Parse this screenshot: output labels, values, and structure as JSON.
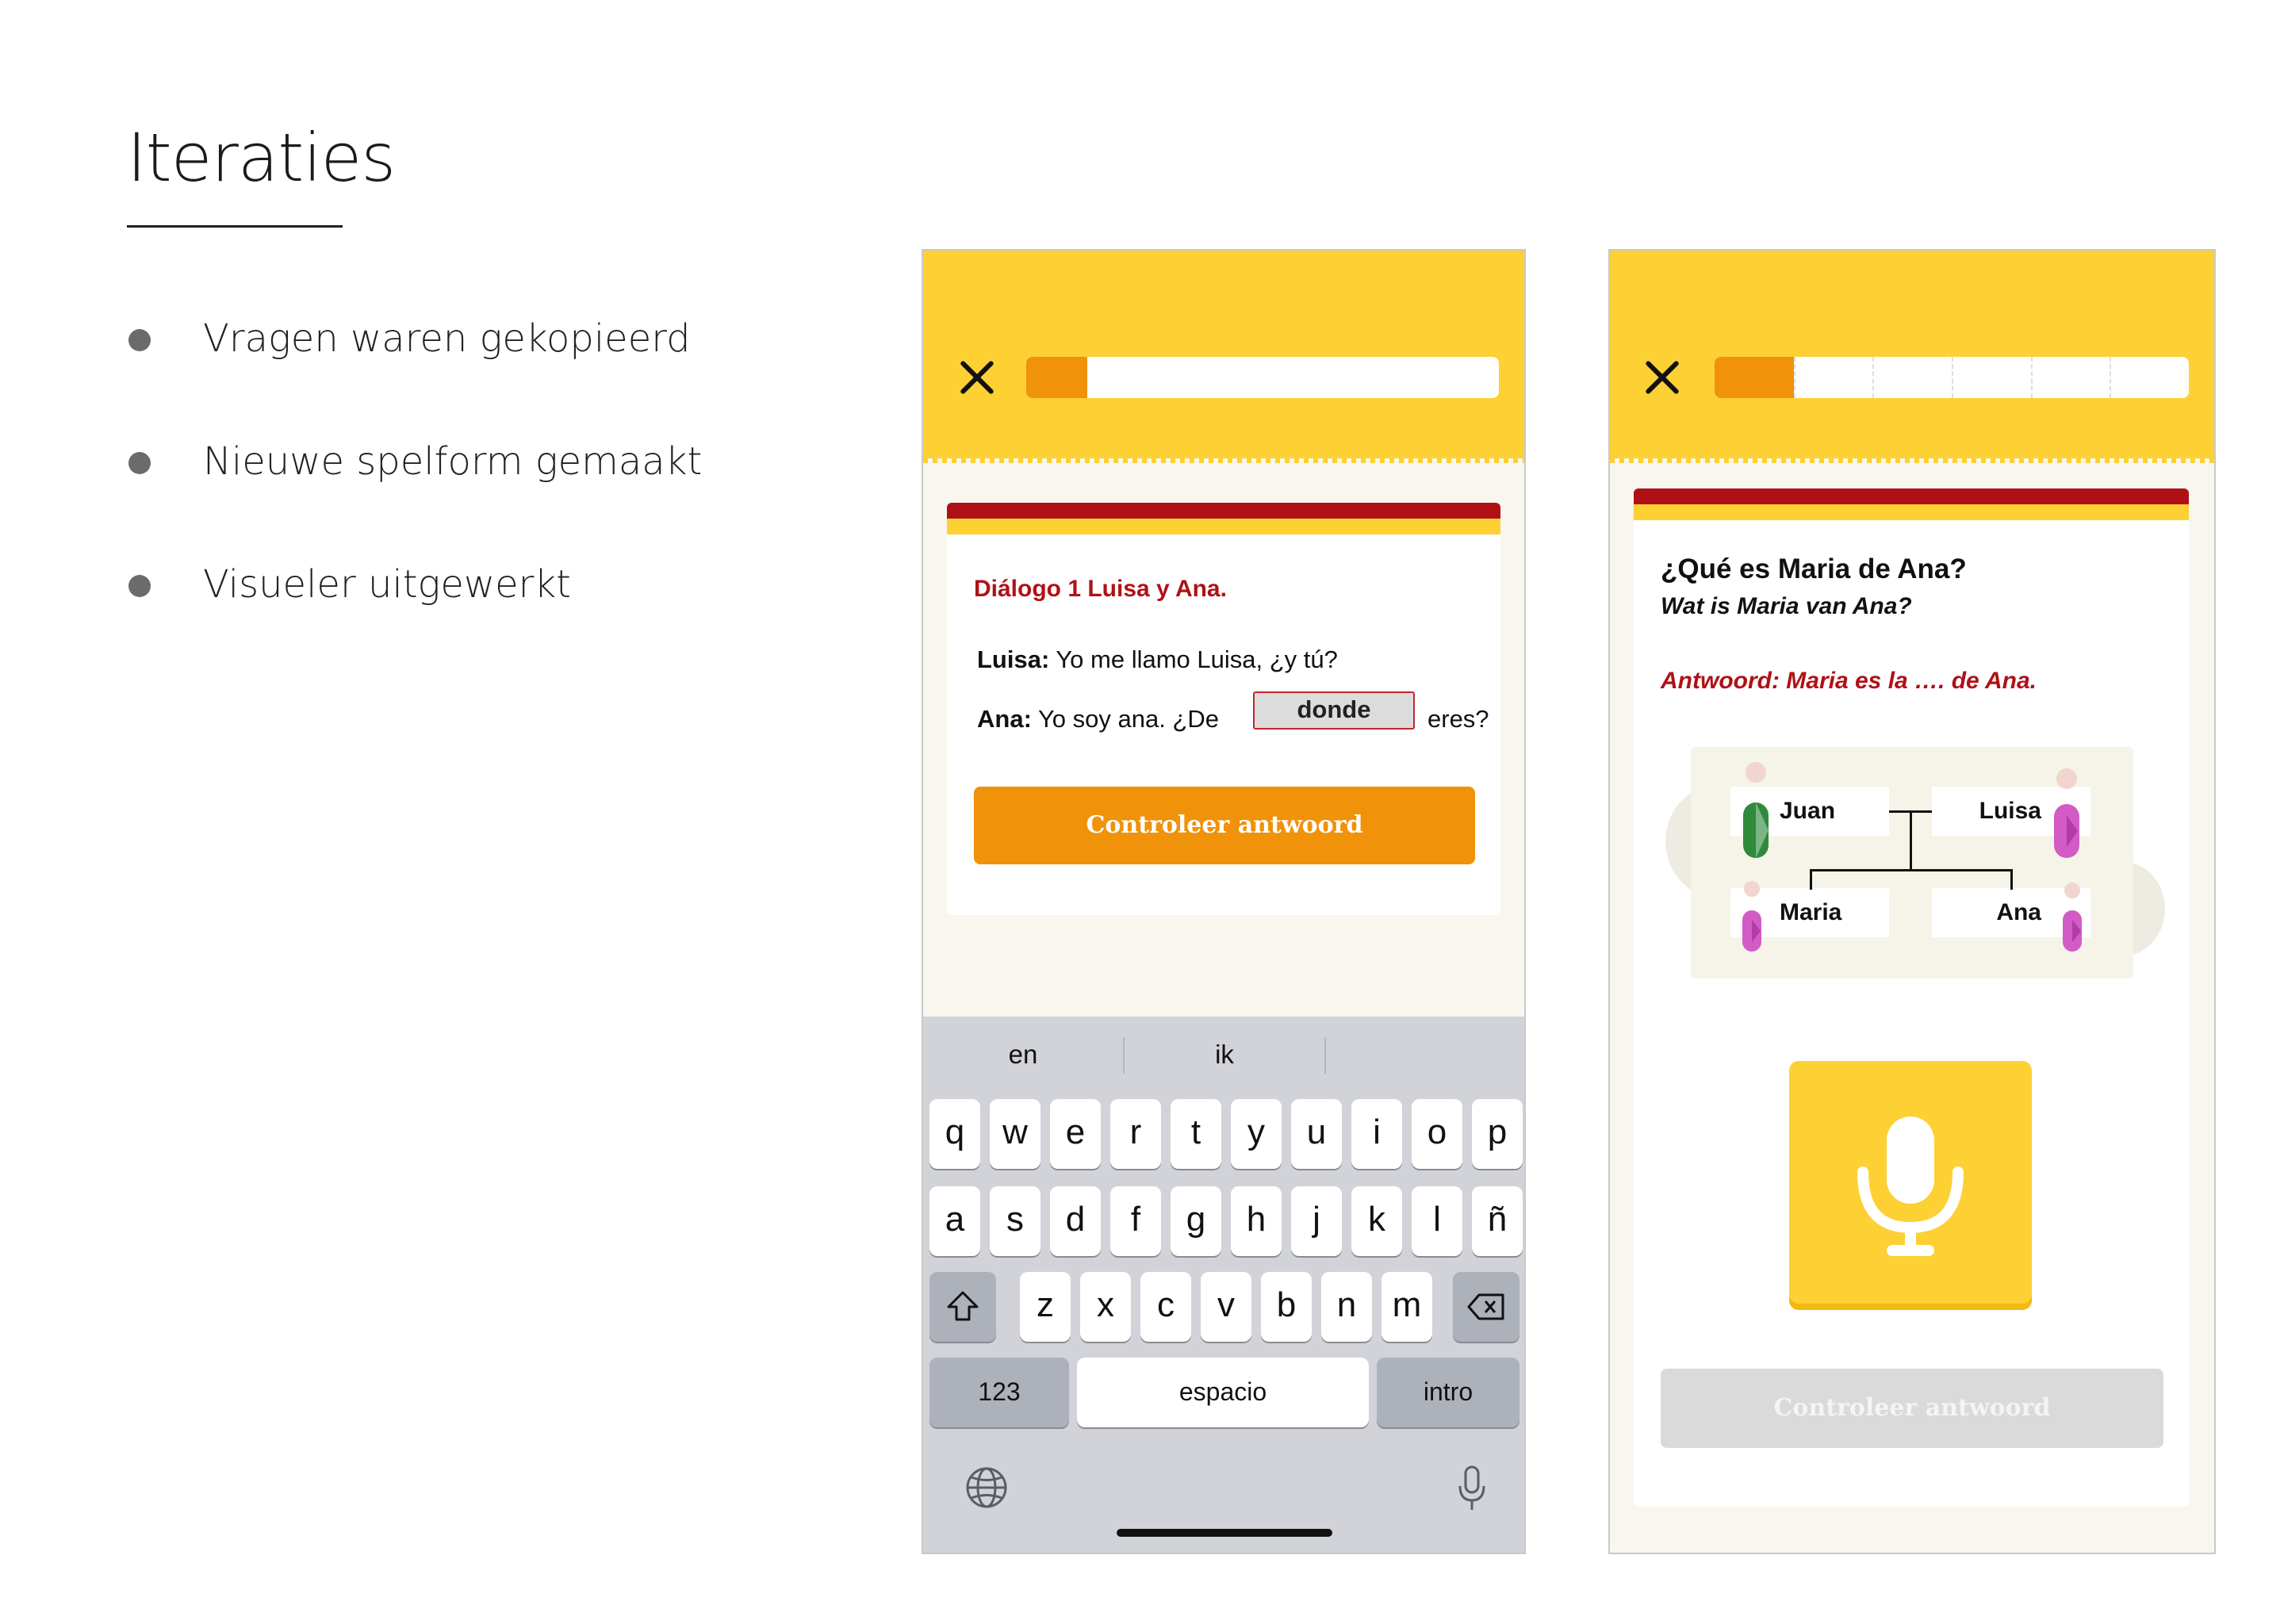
{
  "slide": {
    "title": "Iteraties",
    "bullets": [
      {
        "text": "Vragen waren gekopieerd"
      },
      {
        "text": "Nieuwe spelform gemaakt"
      },
      {
        "text": "Visueler uitgewerkt"
      }
    ]
  },
  "colors": {
    "yellow": "#fdd034",
    "orange": "#f0920a",
    "red": "#b01116"
  },
  "left_screen": {
    "progress": 0.13,
    "close_icon": "close-icon",
    "dialog_title": "Diálogo 1 Luisa y Ana.",
    "line1_speaker": "Luisa:",
    "line1_text": " Yo me llamo Luisa, ¿y tú?",
    "line2_speaker": "Ana:",
    "line2_text": " Yo soy ana. ¿De",
    "answer_value": "donde",
    "line2_after": "eres?",
    "check_button": "Controleer antwoord",
    "keyboard": {
      "suggestions": [
        "en",
        "ik"
      ],
      "row1": [
        "q",
        "w",
        "e",
        "r",
        "t",
        "y",
        "u",
        "i",
        "o",
        "p"
      ],
      "row2": [
        "a",
        "s",
        "d",
        "f",
        "g",
        "h",
        "j",
        "k",
        "l",
        "ñ"
      ],
      "row3": [
        "z",
        "x",
        "c",
        "v",
        "b",
        "n",
        "m"
      ],
      "shift_icon": "shift-icon",
      "backspace_icon": "backspace-icon",
      "numbers_key": "123",
      "space_key": "espacio",
      "return_key": "intro",
      "globe_icon": "globe-icon",
      "dictation_icon": "microphone-icon"
    }
  },
  "right_screen": {
    "progress": 0.167,
    "progress_segments": 6,
    "close_icon": "close-icon",
    "question": "¿Qué es Maria de Ana?",
    "question_translation": "Wat is Maria van Ana?",
    "answer_hint": "Antwoord: Maria es la …. de Ana.",
    "family": {
      "parent_1": "Juan",
      "parent_2": "Luisa",
      "child_1": "Maria",
      "child_2": "Ana"
    },
    "mic_icon": "microphone-icon",
    "check_button": "Controleer antwoord",
    "check_button_state": "disabled"
  }
}
